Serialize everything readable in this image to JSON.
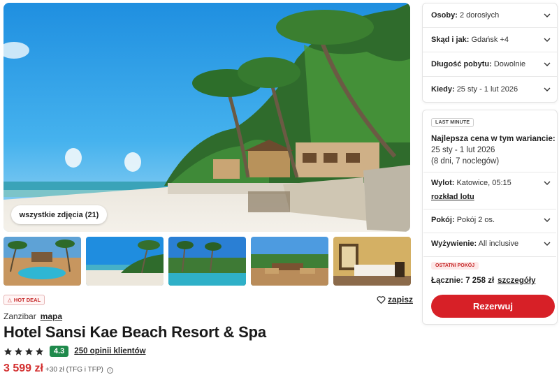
{
  "gallery": {
    "all_photos_label": "wszystkie zdjęcia (21)",
    "thumbnails": [
      "pool-photo",
      "beach-photo",
      "garden-pool-photo",
      "lounge-photo",
      "room-photo"
    ]
  },
  "hotel": {
    "hot_deal_label": "HOT DEAL",
    "save_label": "zapisz",
    "location": "Zanzibar",
    "map_link": "mapa",
    "name": "Hotel Sansi Kae Beach Resort & Spa",
    "stars": 4,
    "score": "4.3",
    "reviews_label": "250 opinii klientów",
    "price": "3 599 zł",
    "price_extra": "+30 zł (TFG i TFP)"
  },
  "filters": {
    "people": {
      "label": "Osoby:",
      "value": "2 dorosłych"
    },
    "from": {
      "label": "Skąd i jak:",
      "value": "Gdańsk +4"
    },
    "duration": {
      "label": "Długość pobytu:",
      "value": "Dowolnie"
    },
    "when": {
      "label": "Kiedy:",
      "value": "25 sty - 1 lut 2026"
    }
  },
  "offer": {
    "badge": "LAST MINUTE",
    "best_price_title": "Najlepsza cena w tym wariancie:",
    "dates": "25 sty - 1 lut 2026",
    "nights": "(8 dni, 7 noclegów)",
    "flight_label": "Wylot:",
    "flight_value": "Katowice, 05:15",
    "flight_schedule_link": "rozkład lotu",
    "room_label": "Pokój:",
    "room_value": "Pokój 2 os.",
    "board_label": "Wyżywienie:",
    "board_value": "All inclusive",
    "last_room_badge": "OSTATNI POKÓJ",
    "total_label": "Łącznie:",
    "total_value": "7 258 zł",
    "details_link": "szczegóły",
    "book_button": "Rezerwuj"
  },
  "colors": {
    "accent_red": "#d72027",
    "score_green": "#1f8a4c",
    "price_red": "#d32f2f"
  }
}
